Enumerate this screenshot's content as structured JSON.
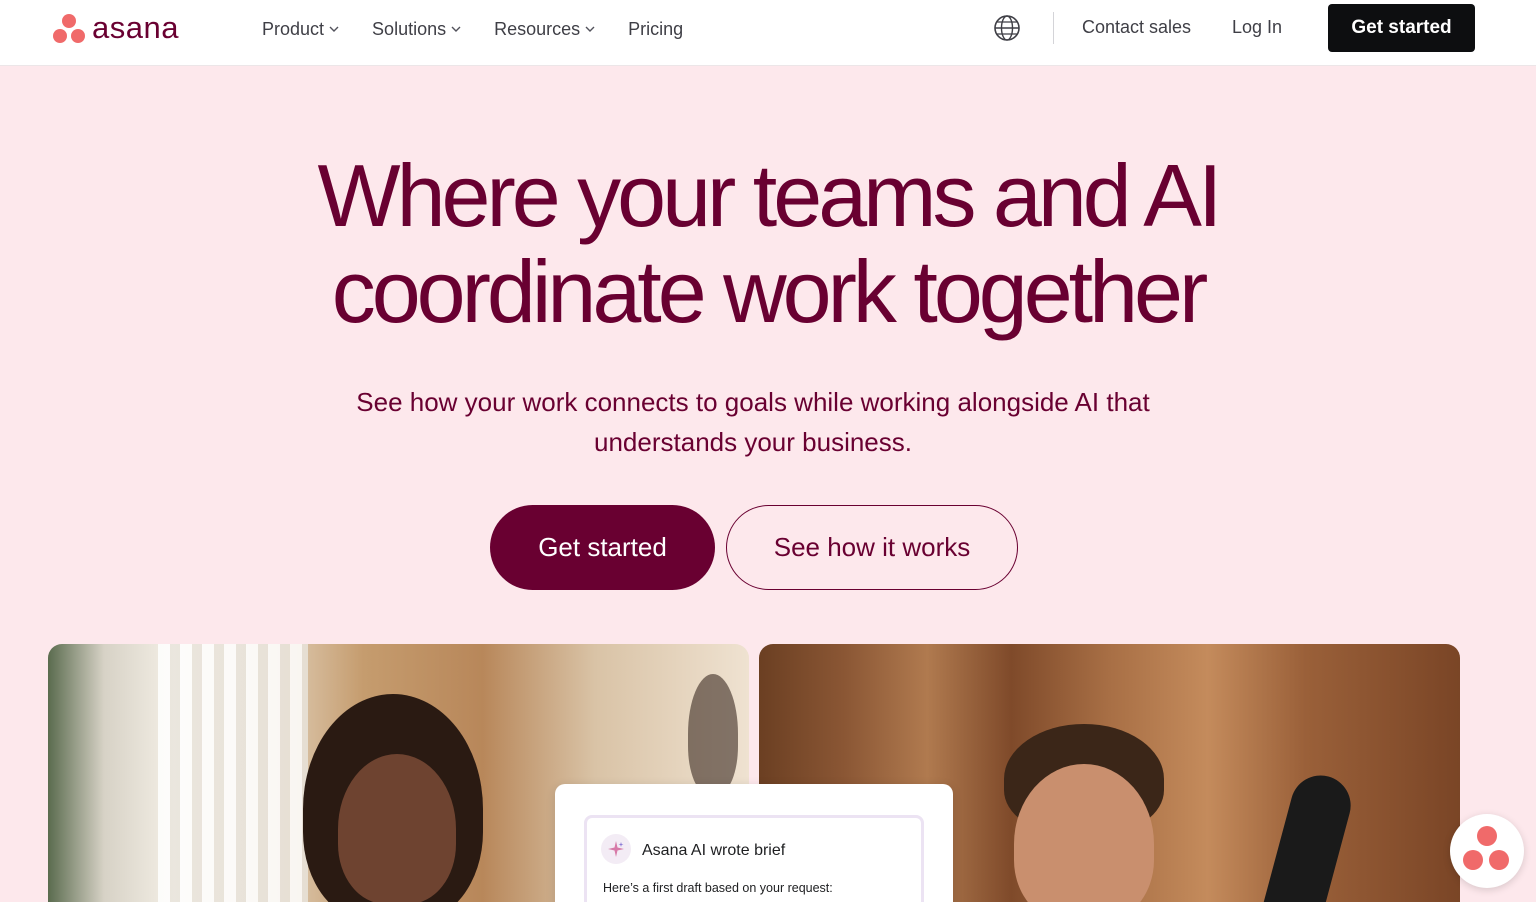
{
  "brand": {
    "name": "asana",
    "color": "#f06a6a",
    "text_color": "#690031"
  },
  "nav": {
    "items": [
      {
        "label": "Product",
        "has_dropdown": true
      },
      {
        "label": "Solutions",
        "has_dropdown": true
      },
      {
        "label": "Resources",
        "has_dropdown": true
      },
      {
        "label": "Pricing",
        "has_dropdown": false
      }
    ],
    "globe_icon": "globe-icon",
    "contact_label": "Contact sales",
    "login_label": "Log In",
    "cta_label": "Get started"
  },
  "hero": {
    "title_line1": "Where your teams and AI",
    "title_line2": "coordinate work together",
    "subtitle_line1": "See how your work connects to goals while working alongside AI that",
    "subtitle_line2": "understands your business.",
    "primary_cta": "Get started",
    "secondary_cta": "See how it works"
  },
  "ai_card": {
    "icon": "sparkle-icon",
    "title": "Asana AI wrote brief",
    "text": "Here’s a first draft based on your request:"
  },
  "colors": {
    "background": "#fde8ec",
    "primary": "#690031",
    "nav_cta": "#0d0e10"
  }
}
